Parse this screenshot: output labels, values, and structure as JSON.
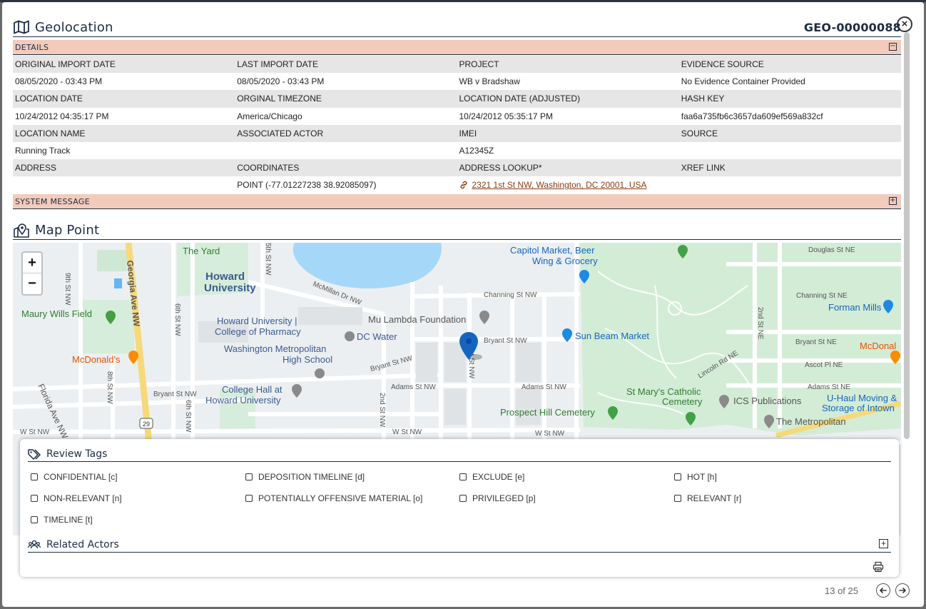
{
  "modal": {
    "title": "Geolocation",
    "record_id": "GEO-00000088",
    "close_label": "×"
  },
  "details": {
    "header": "DETAILS",
    "toggle": "⊟",
    "rows": [
      [
        "ORIGINAL IMPORT DATE",
        "LAST IMPORT DATE",
        "PROJECT",
        "EVIDENCE SOURCE"
      ],
      [
        "08/05/2020 - 03:43 PM",
        "08/05/2020 - 03:43 PM",
        "WB v Bradshaw",
        "No Evidence Container Provided"
      ],
      [
        "LOCATION DATE",
        "ORGINAL TIMEZONE",
        "LOCATION DATE (ADJUSTED)",
        "HASH KEY"
      ],
      [
        "10/24/2012 04:35:17 PM",
        "America/Chicago",
        "10/24/2012 05:35:17 PM",
        "faa6a735fb6c3657da609ef569a832cf"
      ],
      [
        "LOCATION NAME",
        "ASSOCIATED ACTOR",
        "IMEI",
        "SOURCE"
      ],
      [
        "Running Track",
        "",
        "A12345Z",
        ""
      ],
      [
        "ADDRESS",
        "COORDINATES",
        "ADDRESS LOOKUP*",
        "XREF LINK"
      ],
      [
        "",
        "POINT (-77.01227238 38.92085097)",
        "",
        ""
      ]
    ],
    "address_lookup_link": "2321 1st St NW, Washington, DC 20001, USA"
  },
  "system_message": {
    "header": "SYSTEM MESSAGE",
    "toggle": "+"
  },
  "map_point": {
    "title": "Map Point",
    "zoom_in": "+",
    "zoom_out": "−",
    "labels": [
      "The Yard",
      "Howard",
      "University",
      "Howard University |",
      "College of Pharmacy",
      "Washington Metropolitan",
      "High School",
      "College Hall at",
      "Howard University",
      "Maury Wills Field",
      "McDonald's",
      "Georgia Ave NW",
      "McMillan Dr NW",
      "Mu Lambda Foundation",
      "DC Water",
      "Capitol Market, Beer",
      "Wing & Grocery",
      "Sun Beam Market",
      "Channing St NW",
      "Bryant St NW",
      "Adams St NW",
      "W St NW",
      "Prospect Hill Cemetery",
      "St Mary's Catholic",
      "Cemetery",
      "ICS Publications",
      "The Metropolitan",
      "Forman Mills",
      "McDonal",
      "U-Haul Moving &",
      "Storage of Intown",
      "Douglas St NE",
      "Channing St NE",
      "Bryant St NE",
      "Ascot Pl NE",
      "Adams St NE",
      "Lincoln Rd NE",
      "2nd St NE",
      "9th St NW",
      "8th St NW",
      "6th St NW",
      "5th St NW",
      "Florida Ave NW",
      "2nd St NW",
      "1st St NW",
      "29"
    ]
  },
  "review_tags": {
    "title": "Review Tags",
    "tags": [
      "CONFIDENTIAL [c]",
      "DEPOSITION TIMELINE [d]",
      "EXCLUDE [e]",
      "HOT [h]",
      "NON-RELEVANT [n]",
      "POTENTIALLY OFFENSIVE MATERIAL [o]",
      "PRIVILEGED [p]",
      "RELEVANT [r]",
      "TIMELINE [t]"
    ]
  },
  "related_actors": {
    "title": "Related Actors",
    "toggle": "+"
  },
  "pager": {
    "text": "13 of 25"
  },
  "colors": {
    "navy": "#1d2d44",
    "section_bg": "#f2cbbb",
    "label_row_bg": "#e6e6e6",
    "link": "#8a3a14",
    "marker": "#1565c0",
    "water": "#9fd6f7",
    "park": "#c8e6c9"
  },
  "icons": {
    "title": "map-icon",
    "map_point": "map-pin-icon",
    "review_tags": "tags-icon",
    "related_actors": "users-icon",
    "link": "link-icon",
    "print": "print-icon",
    "prev": "arrow-left-icon",
    "next": "arrow-right-icon",
    "close": "close-icon"
  }
}
